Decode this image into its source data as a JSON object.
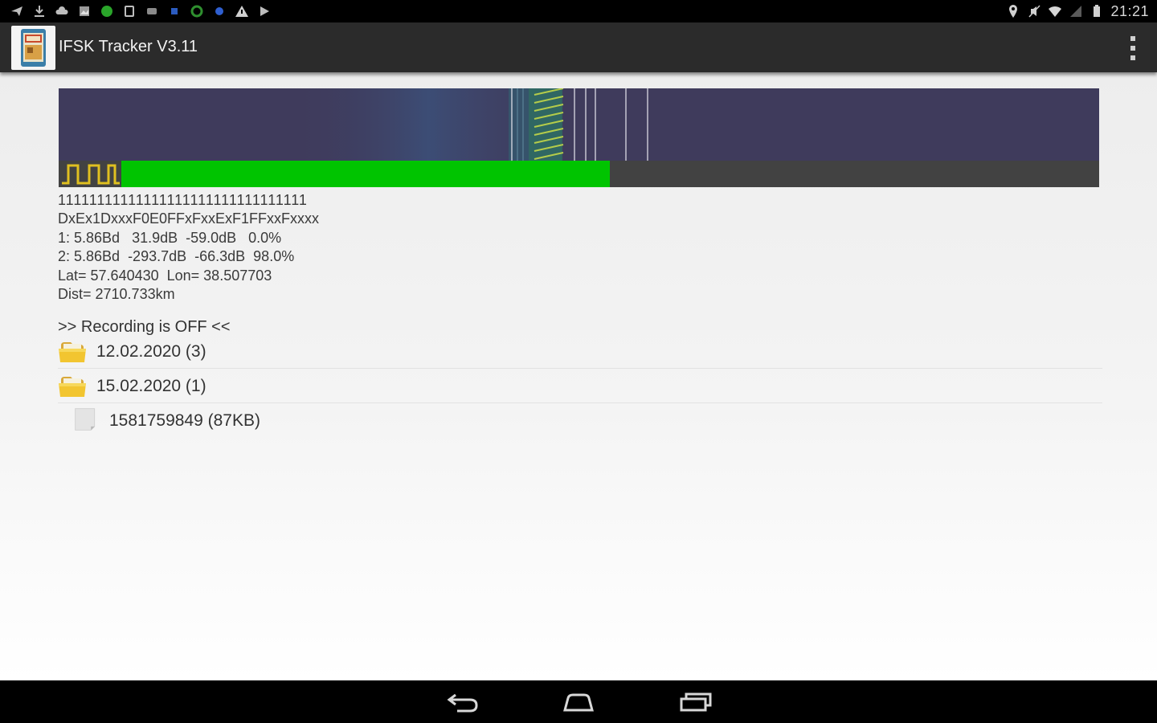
{
  "status_bar": {
    "left_icons": [
      "send-icon",
      "download-icon",
      "cloud-icon",
      "photo-icon",
      "green-circle-icon",
      "sd-card-icon",
      "cast-icon",
      "blue-square-icon",
      "green-ring-icon",
      "blue-dot-icon",
      "warning-icon",
      "play-icon"
    ],
    "right_icons": [
      "location-icon",
      "mute-icon",
      "wifi-icon",
      "signal-icon",
      "battery-icon"
    ],
    "time": "21:21"
  },
  "action_bar": {
    "title": "IFSK Tracker V3.11",
    "overflow_icon": "more-vertical-icon"
  },
  "signal_level": {
    "fill_fraction": 0.53,
    "fill_color": "#00c400"
  },
  "decode": {
    "bits": "11111111111111111111111111111111",
    "hex": "DxEx1DxxxF0E0FFxFxxExF1FFxxFxxxx",
    "ch1": "1: 5.86Bd   31.9dB  -59.0dB   0.0%",
    "ch2": "2: 5.86Bd  -293.7dB  -66.3dB  98.0%",
    "position": "Lat= 57.640430  Lon= 38.507703",
    "distance": "Dist= 2710.733km"
  },
  "recording_status": ">> Recording is OFF <<",
  "files": [
    {
      "type": "folder",
      "label": "12.02.2020 (3)",
      "icon": "folder-icon"
    },
    {
      "type": "folder",
      "label": "15.02.2020 (1)",
      "icon": "folder-icon"
    },
    {
      "type": "file",
      "label": "1581759849 (87KB)",
      "icon": "file-icon"
    }
  ],
  "navigation": {
    "back": "back-icon",
    "home": "home-icon",
    "recents": "recents-icon"
  },
  "colors": {
    "spectrum_bg": "#3f3b5c",
    "level_bg": "#424242",
    "level_fill": "#00c400",
    "waveform": "#e0c020"
  }
}
